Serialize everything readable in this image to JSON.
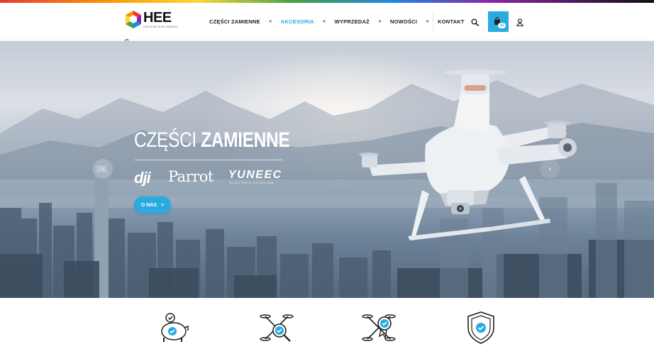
{
  "logo": {
    "word": "HEE",
    "subtitle": "HIGH END ELECTRONICS"
  },
  "nav": {
    "items": [
      {
        "label": "CZĘŚCI ZAMIENNE",
        "active": false
      },
      {
        "label": "AKCESORIA",
        "active": true
      },
      {
        "label": "WYPRZEDAŻ",
        "active": false
      },
      {
        "label": "NOWOŚCI",
        "active": false
      },
      {
        "label": "KONTAKT",
        "active": false
      }
    ],
    "separator": "✕"
  },
  "header": {
    "cart_count": "12",
    "search_icon": "search-icon",
    "cart_icon": "shopping-bag-icon",
    "user_icon": "user-icon"
  },
  "hero": {
    "title_light": "CZĘŚCI",
    "title_bold": "ZAMIENNE",
    "brands": {
      "dji": "dji",
      "parrot": "Parrot",
      "yuneec": "YUNEEC",
      "yuneec_sub": "ELECTRIC AVIATION"
    },
    "cta_label": "O NAS",
    "cta_arrow": ">",
    "prev_arrow": "‹",
    "next_arrow": "›"
  },
  "features": [
    {
      "icon": "piggy-bank-check-icon"
    },
    {
      "icon": "drone-search-check-icon"
    },
    {
      "icon": "drone-award-check-icon"
    },
    {
      "icon": "shield-check-icon"
    }
  ],
  "colors": {
    "accent": "#29abe2",
    "text": "#222222"
  }
}
